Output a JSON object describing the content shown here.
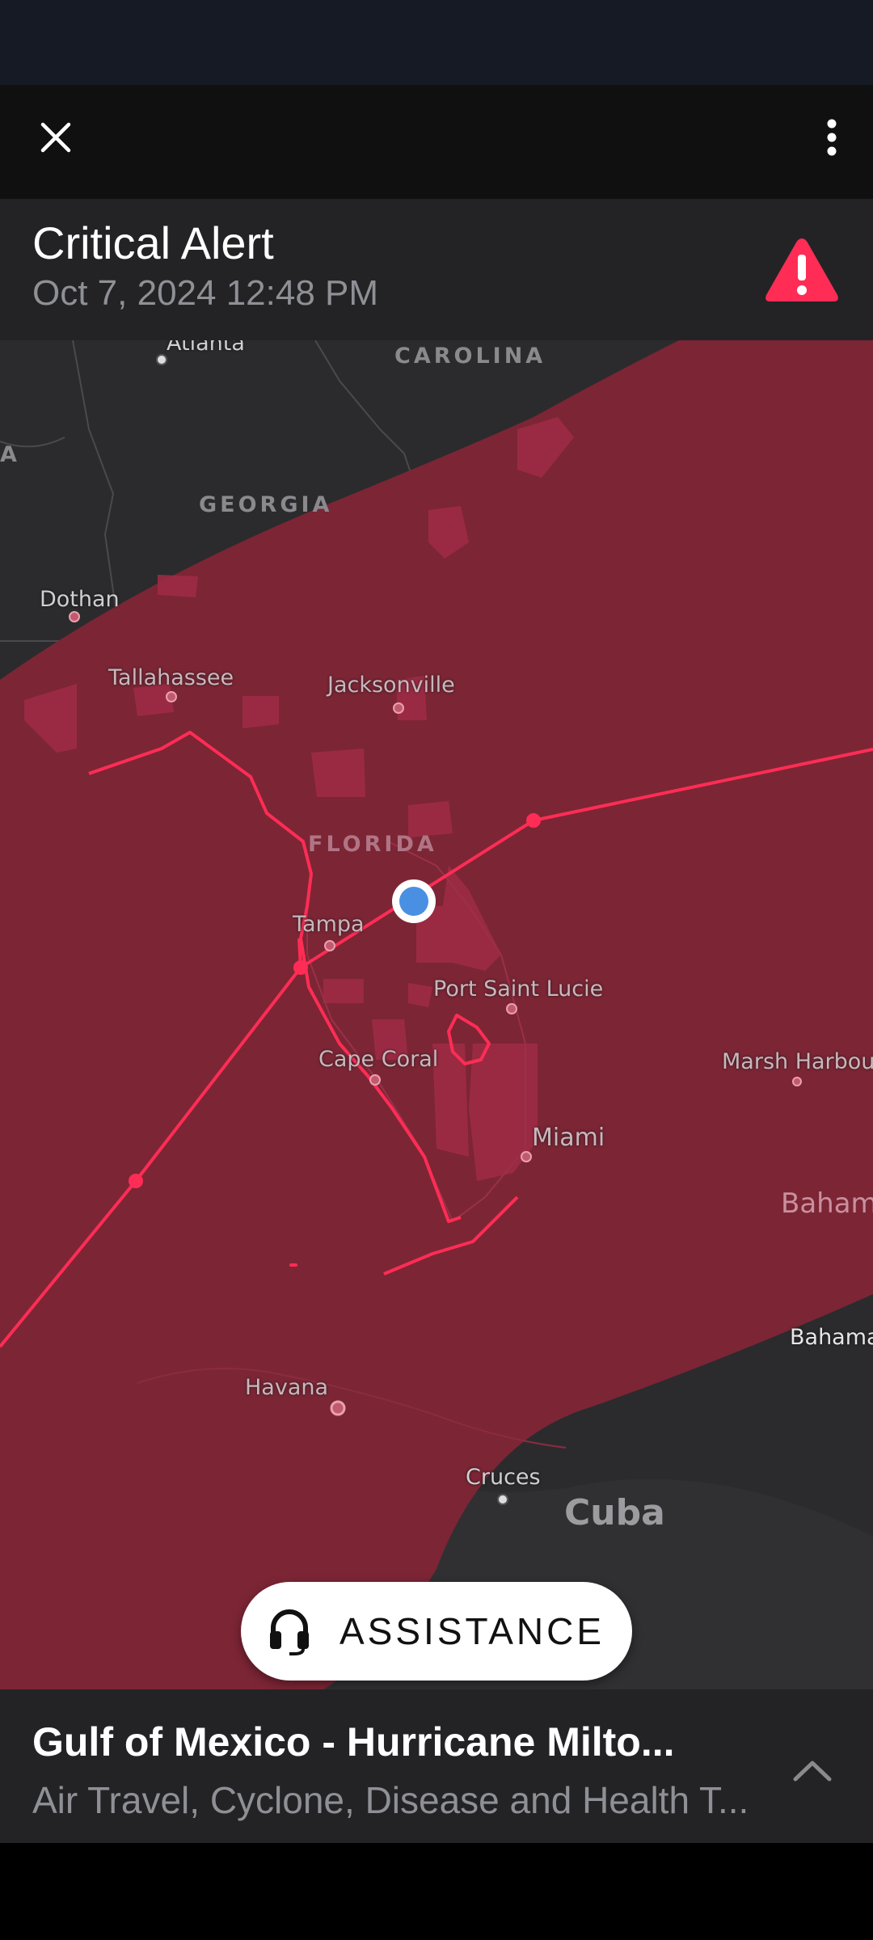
{
  "header": {
    "close_icon": "close-icon",
    "more_icon": "more-vertical-icon"
  },
  "alert": {
    "title": "Critical Alert",
    "datetime": "Oct 7, 2024 12:48 PM",
    "icon": "warning-triangle-icon",
    "accent_color": "#ff2d55"
  },
  "map": {
    "labels": {
      "atlanta": "Atlanta",
      "carolina": "CAROLINA",
      "a_edge": "A",
      "georgia": "GEORGIA",
      "dothan": "Dothan",
      "tallahassee": "Tallahassee",
      "jacksonville": "Jacksonville",
      "florida": "FLORIDA",
      "tampa": "Tampa",
      "port_saint_lucie": "Port Saint Lucie",
      "cape_coral": "Cape Coral",
      "marsh_harbour": "Marsh Harbour",
      "miami": "Miami",
      "bahamas_region": "Baham",
      "bahamas": "Bahama",
      "havana": "Havana",
      "cruces": "Cruces",
      "cuba": "Cuba"
    },
    "colors": {
      "affected_area": "#7c2535",
      "track_line": "#ff2d55",
      "user_location": "#4a90e2"
    }
  },
  "assistance": {
    "label": "ASSISTANCE",
    "icon": "headset-icon"
  },
  "event": {
    "title": "Gulf of Mexico - Hurricane Milto...",
    "categories": "Air Travel, Cyclone, Disease and Health T...",
    "expand_icon": "chevron-up-icon"
  }
}
